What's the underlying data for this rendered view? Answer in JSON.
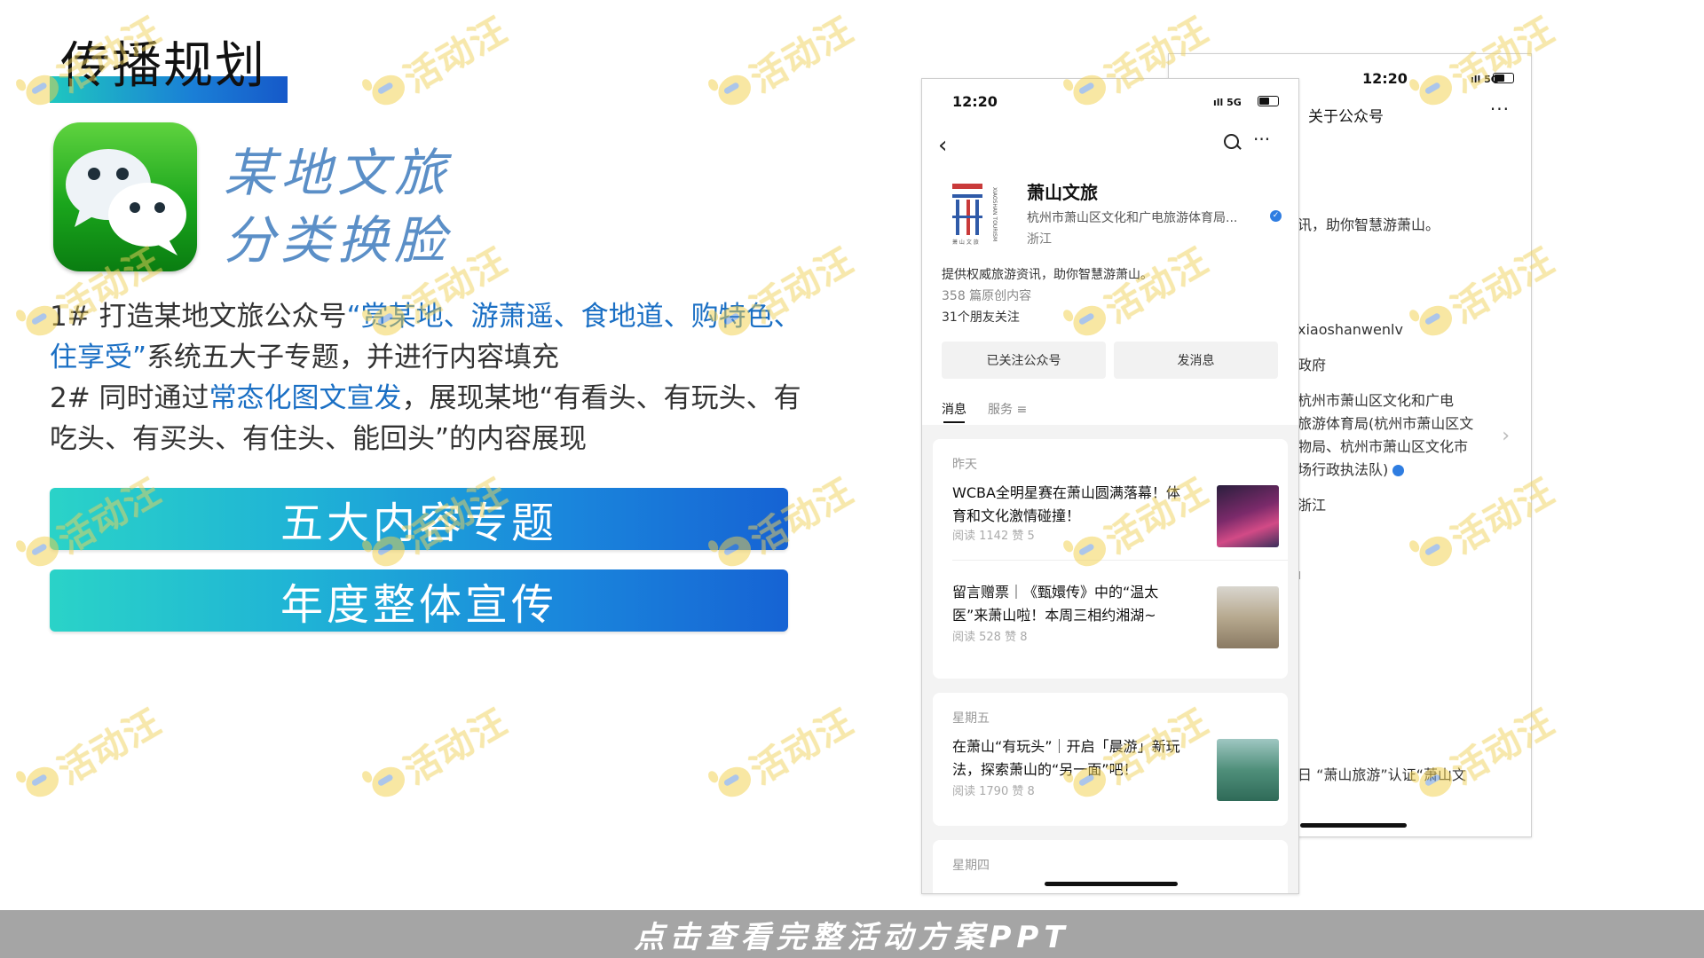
{
  "title": "传播规划",
  "brand": {
    "line1": "某地文旅",
    "line2": "分类换脸"
  },
  "paragraph1": {
    "prefix": "1#  打造某地文旅公众号",
    "highlight": "“赏某地、游萧遥、食地道、购特色、住享受”",
    "suffix": "系统五大子专题，并进行内容填充"
  },
  "paragraph2": {
    "prefix": "2#  同时通过",
    "highlight": "常态化图文宣发",
    "suffix": "，展现某地“有看头、有玩头、有吃头、有买头、有住头、能回头”的内容展现"
  },
  "bars": [
    "五大内容专题",
    "年度整体宣传"
  ],
  "phone_back": {
    "time": "12:20",
    "signal": "5G",
    "nav_title": "关于公众号",
    "more": "···",
    "desc_tail": "讯，助你智慧游萧山。",
    "id_tail": "xiaoshanwenlv",
    "type_tail": "政府",
    "org_lines": [
      "杭州市萧山区文化和广电",
      "旅游体育局(杭州市萧山区文",
      "物局、杭州市萧山区文化市",
      "场行政执法队)"
    ],
    "loc_tail": "浙江",
    "mark": "ı",
    "trademark_tail": "日 “萧山旅游”认证“萧山文"
  },
  "phone_front": {
    "time": "12:20",
    "signal": "5G",
    "account_name": "萧山文旅",
    "logo_side_text": "XIAOSHAN TOURISM",
    "logo_bottom_text": "萧 山 文 旅",
    "org": "杭州市萧山区文化和广电旅游体育局...",
    "location": "浙江",
    "description": "提供权威旅游资讯，助你智慧游萧山。",
    "articles_count": "358 篇原创内容",
    "friends": "31个朋友关注",
    "follow_button": "已关注公众号",
    "message_button": "发消息",
    "tabs": [
      "消息",
      "服务 ≡"
    ],
    "groups": [
      {
        "day": "昨天",
        "articles": [
          {
            "title": "WCBA全明星赛在萧山圆满落幕！体育和文化激情碰撞！",
            "meta": "阅读 1142   赞 5"
          },
          {
            "title": "留言赠票｜《甄嬛传》中的“温太医”来萧山啦！本周三相约湘湖~",
            "meta": "阅读 528   赞 8"
          }
        ]
      },
      {
        "day": "星期五",
        "articles": [
          {
            "title": "在萧山“有玩头”｜开启「晨游」新玩法，探索萧山的“另一面”吧！",
            "meta": "阅读 1790   赞 8"
          }
        ]
      },
      {
        "day": "星期四",
        "articles": []
      }
    ]
  },
  "watermark_text": "活动汪",
  "footer": "点击查看完整活动方案PPT",
  "colors": {
    "accent": "#1a6fc4",
    "bar_start": "#2ad3c8",
    "bar_end": "#1663d4",
    "footer_bg": "#a5a5a5",
    "brand_text": "#5b8fc7"
  }
}
